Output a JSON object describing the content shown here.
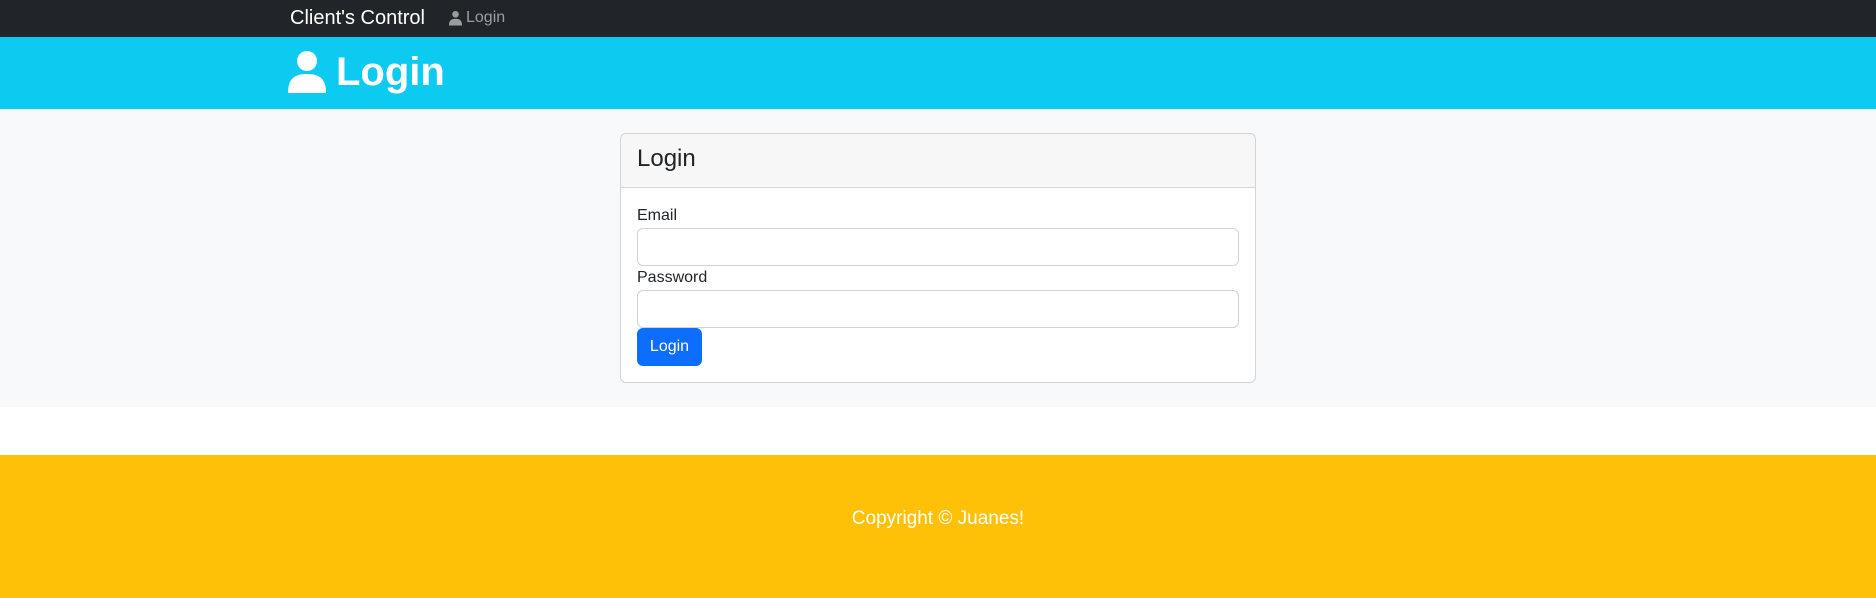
{
  "navbar": {
    "brand": "Client's Control",
    "link_label": "Login",
    "link_icon": "user-icon"
  },
  "header": {
    "title": "Login",
    "icon": "user-icon"
  },
  "login_card": {
    "title": "Login",
    "email_label": "Email",
    "email_value": "",
    "password_label": "Password",
    "password_value": "",
    "submit_label": "Login"
  },
  "footer": {
    "text": "Copyright © Juanes!"
  },
  "colors": {
    "navbar_bg": "#212529",
    "header_bg": "#0dcaf0",
    "main_bg": "#f8f9fa",
    "button_primary": "#0d6efd",
    "footer_bg": "#ffc107"
  }
}
